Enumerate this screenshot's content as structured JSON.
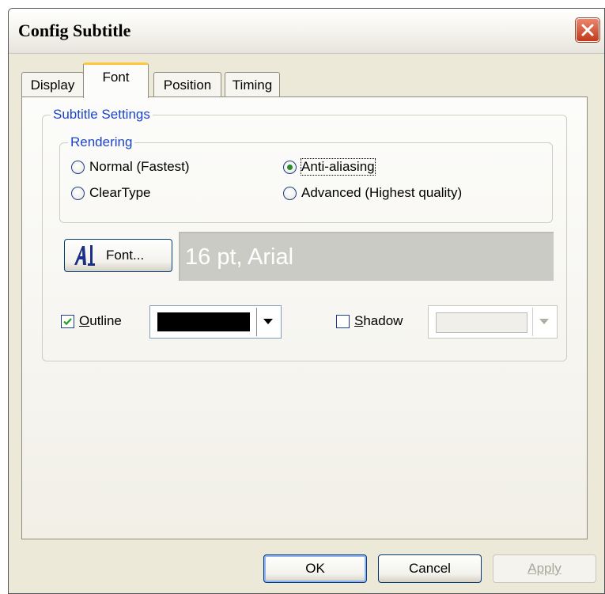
{
  "window": {
    "title": "Config Subtitle"
  },
  "tabs": [
    {
      "label": "Display",
      "active": false
    },
    {
      "label": "Font",
      "active": true
    },
    {
      "label": "Position",
      "active": false
    },
    {
      "label": "Timing",
      "active": false
    }
  ],
  "subtitle_settings": {
    "legend": "Subtitle Settings",
    "rendering": {
      "legend": "Rendering",
      "options": [
        {
          "label": "Normal (Fastest)",
          "checked": false
        },
        {
          "label": "Anti-aliasing",
          "checked": true
        },
        {
          "label": "ClearType",
          "checked": false
        },
        {
          "label": "Advanced (Highest quality)",
          "checked": false
        }
      ]
    },
    "font_button": {
      "label": "Font..."
    },
    "font_preview": "16 pt, Arial",
    "outline": {
      "label_key": "O",
      "label_rest": "utline",
      "checked": true,
      "color": "#000000"
    },
    "shadow": {
      "label_key": "S",
      "label_rest": "hadow",
      "checked": false,
      "enabled": false
    }
  },
  "buttons": {
    "ok": "OK",
    "cancel": "Cancel",
    "apply": "Apply"
  },
  "colors": {
    "accent_tab": "#ffc83c",
    "legend_text": "#1c44c8",
    "close_button": "#c3381a",
    "radio_checked": "#2a8c2a"
  },
  "icons": {
    "close": "close-x-icon",
    "font": "font-a-icon",
    "dropdown": "chevron-down-icon"
  }
}
